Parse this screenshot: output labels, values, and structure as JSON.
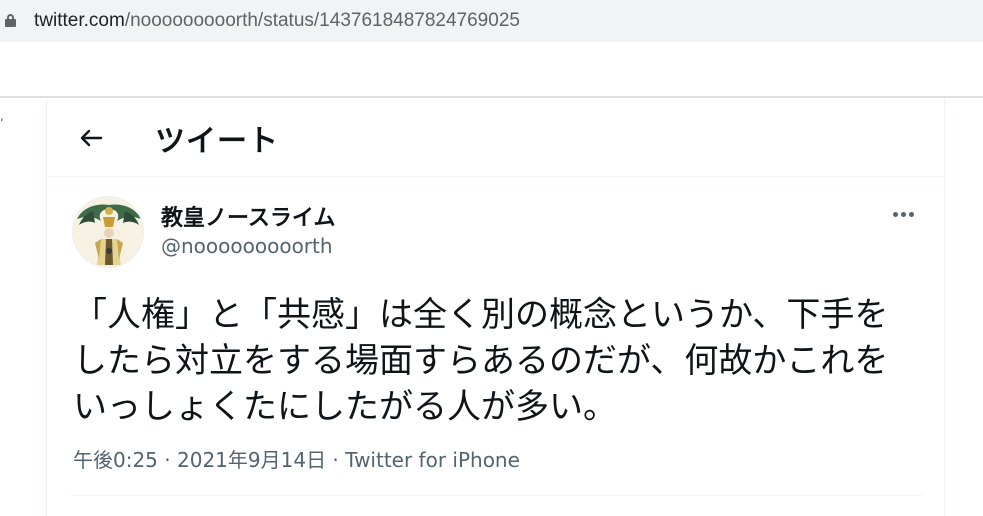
{
  "browser": {
    "url_domain": "twitter.com",
    "url_path": "/nooooooooorth/status/1437618487824769025"
  },
  "header": {
    "title": "ツイート",
    "back_icon": "arrow-left-icon"
  },
  "tweet": {
    "display_name": "教皇ノースライム",
    "handle": "@nooooooooorth",
    "text_lines": [
      "「人権」と「共感」は全く別の概念というか、下手を",
      "したら対立をする場面すらあるのだが、何故かこれを",
      "いっしょくたにしたがる人が多い。"
    ],
    "time": "午後0:25",
    "date": "2021年9月14日",
    "separator": " · ",
    "source": "Twitter for iPhone",
    "more_icon": "more-dots-icon"
  },
  "colors": {
    "text_primary": "#0f1419",
    "text_secondary": "#536471",
    "divider": "#eff3f4",
    "urlbar_bg": "#f1f3f4"
  }
}
